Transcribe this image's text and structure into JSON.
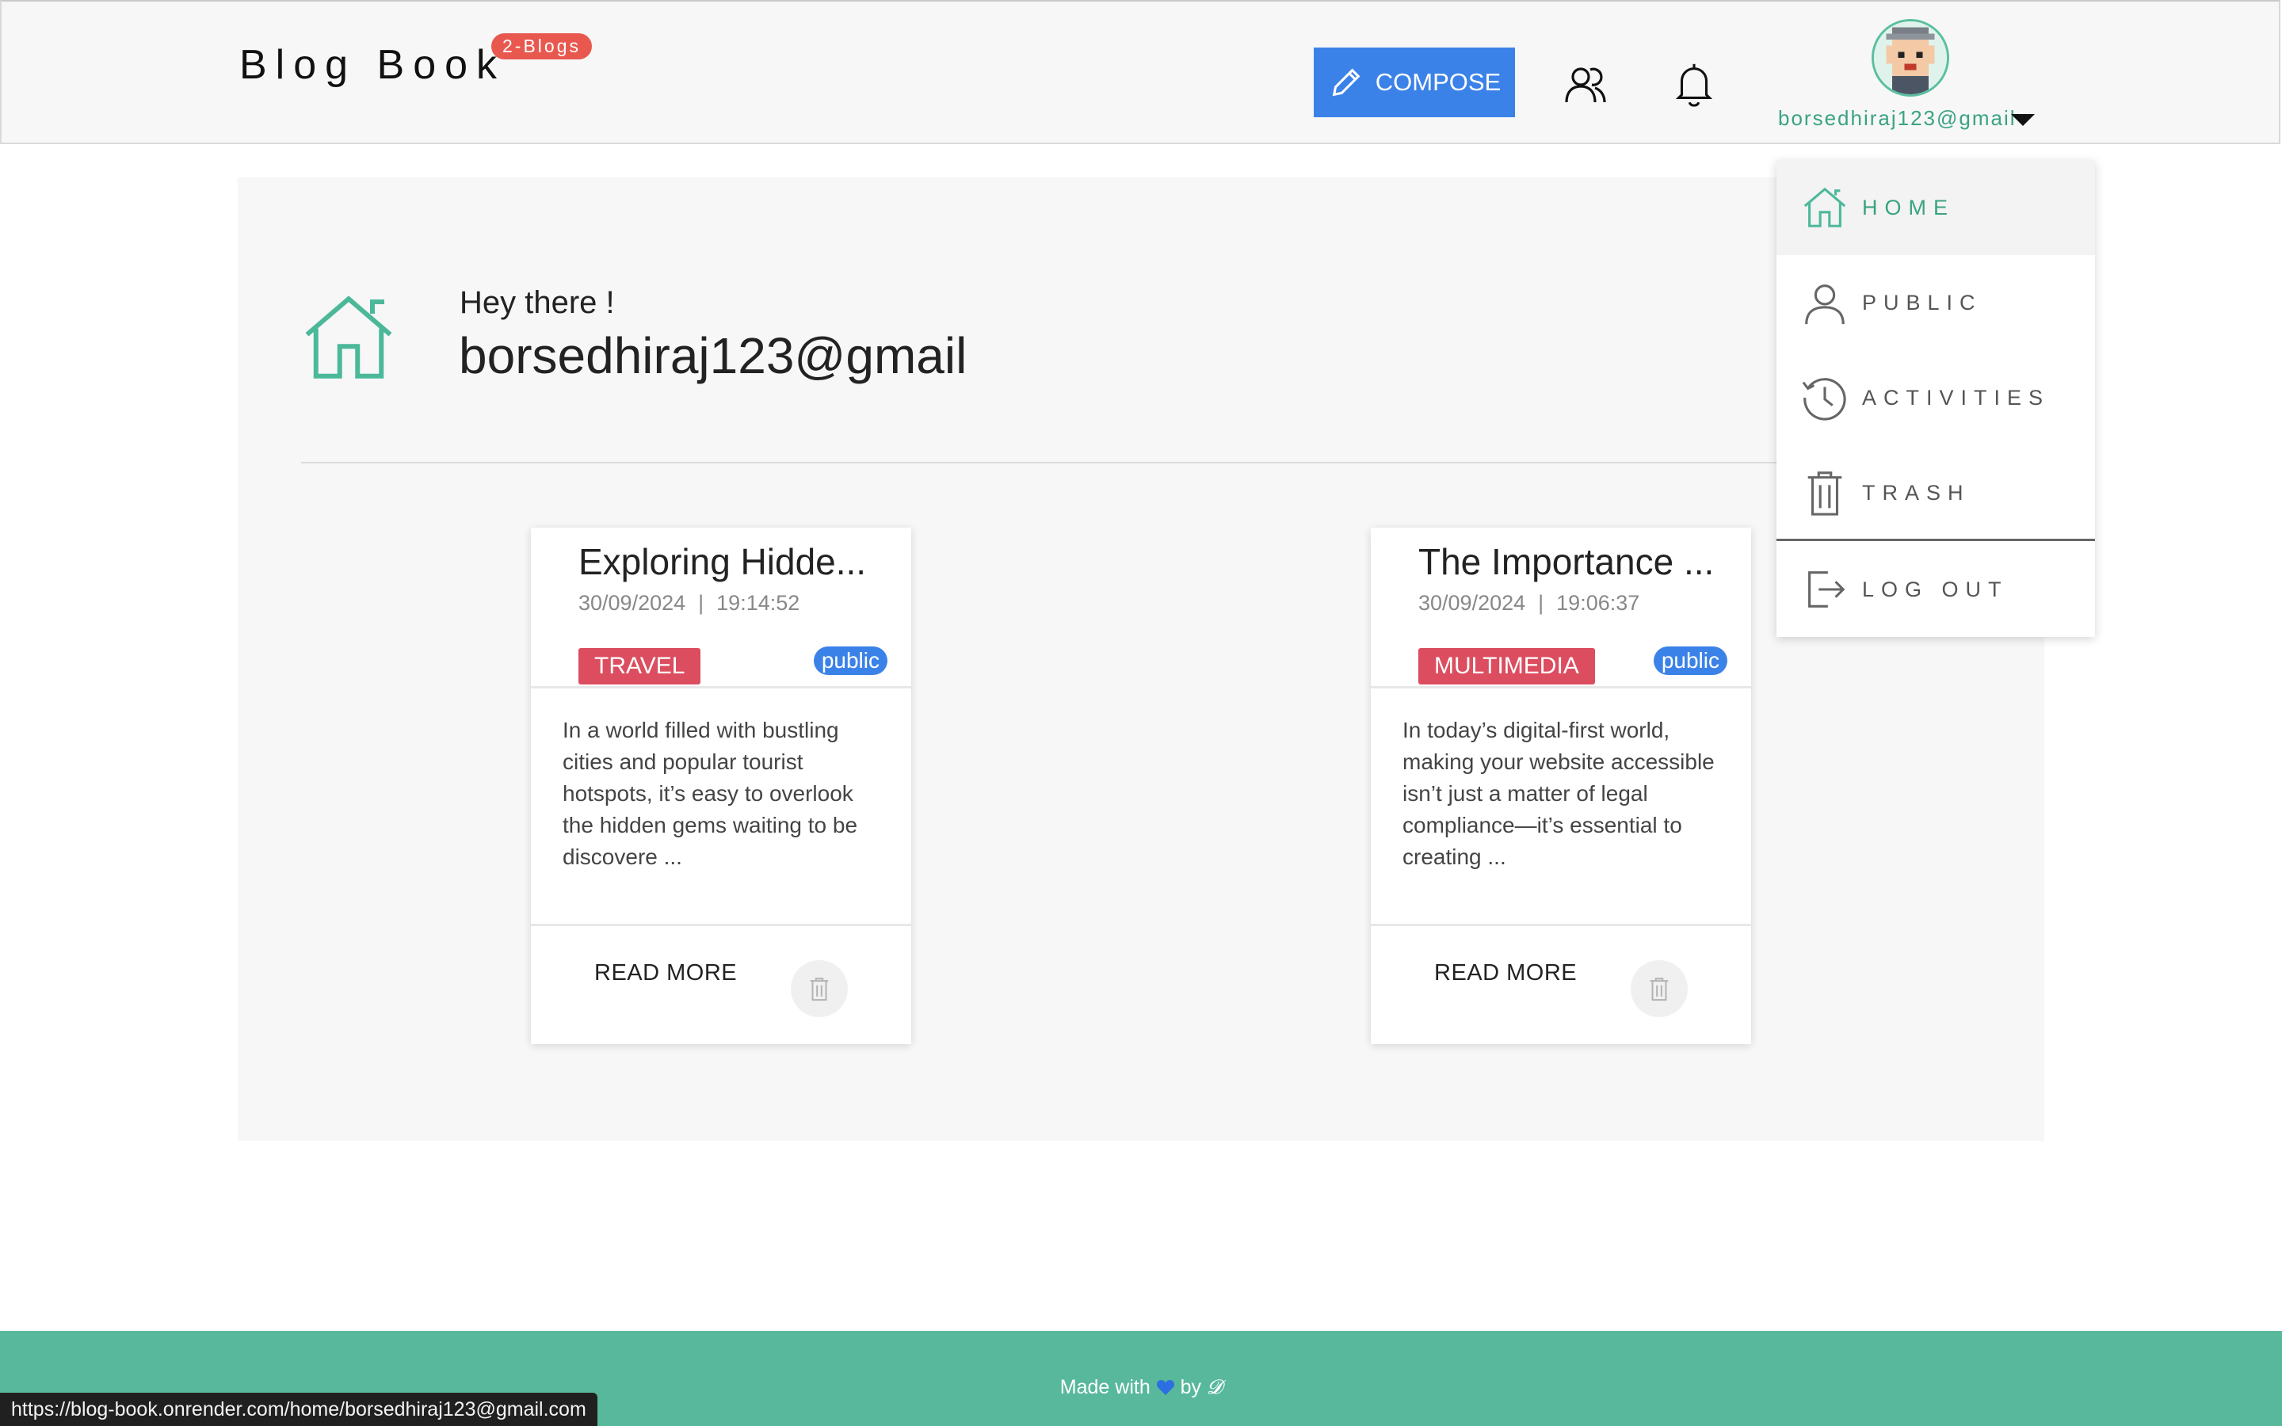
{
  "header": {
    "brand": "Blog Book",
    "blog_count_badge": "2-Blogs",
    "compose_label": "COMPOSE",
    "user_email": "borsedhiraj123@gmail"
  },
  "main": {
    "greeting": "Hey there !",
    "user_email": "borsedhiraj123@gmail"
  },
  "cards": [
    {
      "title": "Exploring Hidde...",
      "date": "30/09/2024",
      "separator": "|",
      "time": "19:14:52",
      "category": "TRAVEL",
      "visibility": "public",
      "excerpt": "In a world filled with bustling cities and popular tourist hotspots, it’s easy to overlook the hidden gems waiting to be discovere ...",
      "read_more": "READ MORE"
    },
    {
      "title": "The Importance ...",
      "date": "30/09/2024",
      "separator": "|",
      "time": "19:06:37",
      "category": "MULTIMEDIA",
      "visibility": "public",
      "excerpt": "In today’s digital-first world, making your website accessible isn’t just a matter of legal compliance—it’s essential to creating ...",
      "read_more": "READ MORE"
    }
  ],
  "menu": {
    "items": [
      {
        "label": "HOME",
        "icon": "home-icon",
        "active": true
      },
      {
        "label": "PUBLIC",
        "icon": "user-icon",
        "active": false
      },
      {
        "label": "ACTIVITIES",
        "icon": "history-icon",
        "active": false
      },
      {
        "label": "TRASH",
        "icon": "trash-icon",
        "active": false
      },
      {
        "label": "LOG OUT",
        "icon": "logout-icon",
        "active": false
      }
    ]
  },
  "footer": {
    "made_with": "Made with",
    "by": "by",
    "signature": "𝓓"
  },
  "status_bar": {
    "url": "https://blog-book.onrender.com/home/borsedhiraj123@gmail.com"
  },
  "colors": {
    "accent_green": "#58b89c",
    "compose_blue": "#3b82e8",
    "badge_red": "#e8584f",
    "tag_red": "#dc4d5f"
  }
}
